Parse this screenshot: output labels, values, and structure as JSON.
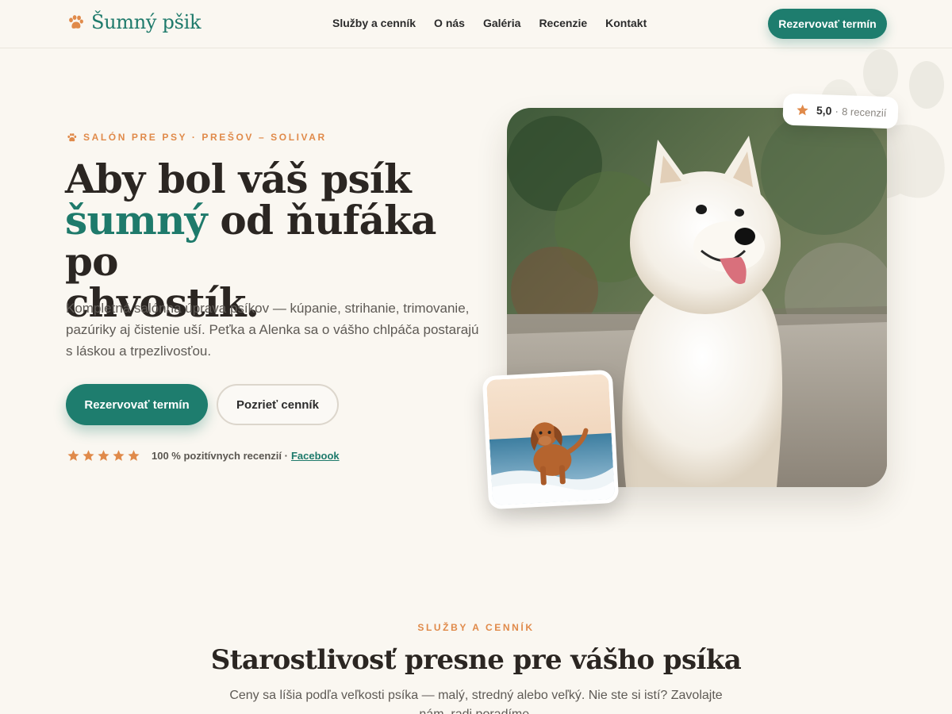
{
  "header": {
    "logo_text": "Šumný pšik",
    "nav": [
      "Služby a cenník",
      "O nás",
      "Galéria",
      "Recenzie",
      "Kontakt"
    ],
    "cta_label": "Rezervovať termín"
  },
  "hero": {
    "eyebrow": "SALÓN PRE PSY · PREŠOV – SOLIVAR",
    "title_line1": "Aby bol váš psík",
    "title_accent": "šumný",
    "title_line2_rest": " od ňufáka po",
    "title_line3": "chvostík.",
    "description": "Kompletná salónna úprava psíkov — kúpanie, strihanie, trimovanie, pazúriky aj čistenie uší. Peťka a Alenka sa o vášho chlpáča postarajú s láskou a trpezlivosťou.",
    "primary_button": "Rezervovať termín",
    "secondary_button": "Pozrieť cenník",
    "rating_text": "100 % pozitívnych recenzií ·",
    "rating_link": "Facebook",
    "stars": 5
  },
  "rating_badge": {
    "score": "5,0",
    "separator": "·",
    "count": "8 recenzií"
  },
  "services": {
    "eyebrow": "SLUŽBY A CENNÍK",
    "title": "Starostlivosť presne pre vášho psíka",
    "description": "Ceny sa líšia podľa veľkosti psíka — malý, stredný alebo veľký. Nie ste si istí? Zavolajte nám, radi poradíme."
  },
  "colors": {
    "accent": "#1e7d6e",
    "highlight": "#e08a4a",
    "background": "#faf7f1"
  },
  "icons": {
    "logo": "paw-icon",
    "star": "star-icon"
  }
}
